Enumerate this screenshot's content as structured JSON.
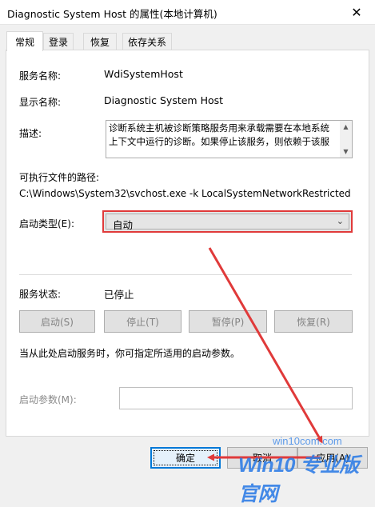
{
  "window": {
    "title": "Diagnostic System Host 的属性(本地计算机)",
    "close_glyph": "✕"
  },
  "tabs": [
    {
      "label": "常规",
      "active": true
    },
    {
      "label": "登录",
      "active": false
    },
    {
      "label": "恢复",
      "active": false
    },
    {
      "label": "依存关系",
      "active": false
    }
  ],
  "general": {
    "service_name_label": "服务名称:",
    "service_name": "WdiSystemHost",
    "display_name_label": "显示名称:",
    "display_name": "Diagnostic System Host",
    "description_label": "描述:",
    "description": "诊断系统主机被诊断策略服务用来承载需要在本地系统上下文中运行的诊断。如果停止该服务，则依赖于该服",
    "exe_path_label": "可执行文件的路径:",
    "exe_path": "C:\\Windows\\System32\\svchost.exe -k LocalSystemNetworkRestricted",
    "startup_type_label": "启动类型(E):",
    "startup_type": "自动",
    "status_label": "服务状态:",
    "status": "已停止",
    "hint": "当从此处启动服务时，你可指定所适用的启动参数。",
    "params_label": "启动参数(M):"
  },
  "service_buttons": [
    {
      "label": "启动(S)"
    },
    {
      "label": "停止(T)"
    },
    {
      "label": "暂停(P)"
    },
    {
      "label": "恢复(R)"
    }
  ],
  "footer": {
    "ok": "确定",
    "cancel": "取消",
    "apply": "应用(A)"
  },
  "watermark": {
    "site": "win10com.com",
    "brand": "Win10 专业版官网"
  },
  "colors": {
    "annotation_red": "#e03a3a",
    "focus_blue": "#0078d7",
    "watermark_blue": "#2c7be6"
  }
}
